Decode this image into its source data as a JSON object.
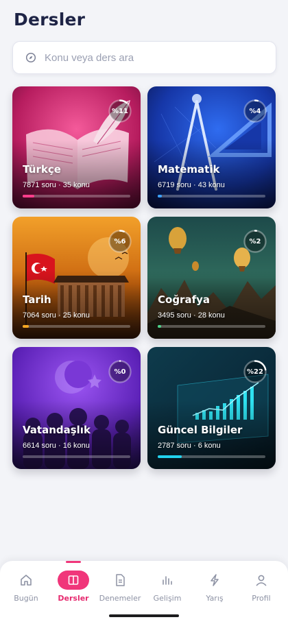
{
  "header": {
    "title": "Dersler"
  },
  "search": {
    "placeholder": "Konu veya ders ara",
    "icon": "compass-icon"
  },
  "subjects": [
    {
      "name": "Türkçe",
      "meta": "7871 soru · 35 konu",
      "percent_label": "%11",
      "progress": 0.11,
      "accent": "#ff3d8b"
    },
    {
      "name": "Matematik",
      "meta": "6719 soru · 43 konu",
      "percent_label": "%4",
      "progress": 0.04,
      "accent": "#3aa0ff"
    },
    {
      "name": "Tarih",
      "meta": "7064 soru · 25 konu",
      "percent_label": "%6",
      "progress": 0.06,
      "accent": "#f5a623"
    },
    {
      "name": "Coğrafya",
      "meta": "3495 soru · 28 konu",
      "percent_label": "%2",
      "progress": 0.02,
      "accent": "#4cd28a"
    },
    {
      "name": "Vatandaşlık",
      "meta": "6614 soru · 16 konu",
      "percent_label": "%0",
      "progress": 0.0,
      "accent": "#b07cff"
    },
    {
      "name": "Güncel Bilgiler",
      "meta": "2787 soru · 6 konu",
      "percent_label": "%22",
      "progress": 0.22,
      "accent": "#22d3ee"
    }
  ],
  "nav": {
    "items": [
      {
        "label": "Bugün",
        "icon": "home-icon"
      },
      {
        "label": "Dersler",
        "icon": "book-icon",
        "active": true
      },
      {
        "label": "Denemeler",
        "icon": "document-icon"
      },
      {
        "label": "Gelişim",
        "icon": "bar-chart-icon"
      },
      {
        "label": "Yarış",
        "icon": "lightning-icon"
      },
      {
        "label": "Profil",
        "icon": "user-icon"
      }
    ]
  },
  "colors": {
    "accent": "#f0367a",
    "background": "#f3f4f8",
    "title": "#1e2446"
  }
}
